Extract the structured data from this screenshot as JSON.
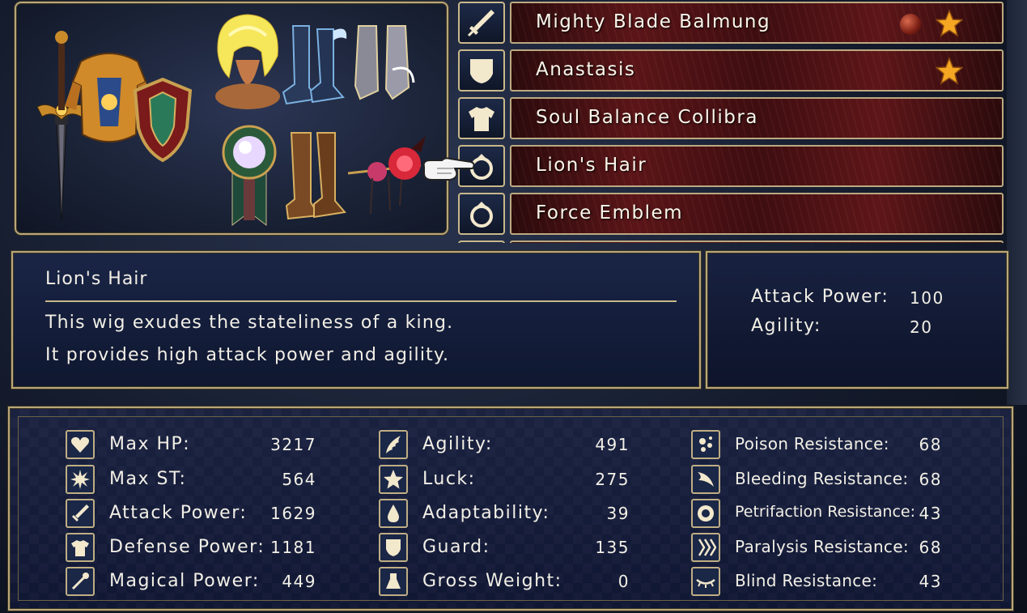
{
  "equipment": [
    {
      "label": "Mighty Blade Balmung",
      "icon": "sword-icon",
      "orb": true,
      "star": true
    },
    {
      "label": "Anastasis",
      "icon": "shield-icon",
      "orb": false,
      "star": true
    },
    {
      "label": "Soul Balance Collibra",
      "icon": "armor-icon",
      "orb": false,
      "star": false
    },
    {
      "label": "Lion's Hair",
      "icon": "ring-icon",
      "orb": false,
      "star": false
    },
    {
      "label": "Force Emblem",
      "icon": "ring-icon",
      "orb": false,
      "star": false
    }
  ],
  "description": {
    "title": "Lion's Hair",
    "line1": "This wig exudes the stateliness of a king.",
    "line2": "It provides high attack power and agility."
  },
  "item_stats": {
    "attack_label": "Attack Power:",
    "attack_value": "100",
    "agility_label": "Agility:",
    "agility_value": "20"
  },
  "stats": {
    "col1": [
      {
        "label": "Max HP:",
        "value": "3217",
        "icon": "heart-icon"
      },
      {
        "label": "Max ST:",
        "value": "564",
        "icon": "burst-icon"
      },
      {
        "label": "Attack Power:",
        "value": "1629",
        "icon": "sword-icon"
      },
      {
        "label": "Defense Power:",
        "value": "1181",
        "icon": "armor-icon"
      },
      {
        "label": "Magical Power:",
        "value": "449",
        "icon": "wand-icon"
      }
    ],
    "col2": [
      {
        "label": "Agility:",
        "value": "491",
        "icon": "wing-icon"
      },
      {
        "label": "Luck:",
        "value": "275",
        "icon": "star-icon"
      },
      {
        "label": "Adaptability:",
        "value": "39",
        "icon": "drop-icon"
      },
      {
        "label": "Guard:",
        "value": "135",
        "icon": "shield-icon"
      },
      {
        "label": "Gross Weight:",
        "value": "0",
        "icon": "weight-icon"
      }
    ],
    "col3": [
      {
        "label": "Poison Resistance:",
        "value": "68",
        "icon": "poison-icon"
      },
      {
        "label": "Bleeding Resistance:",
        "value": "68",
        "icon": "bleed-icon"
      },
      {
        "label": "Petrifaction Resistance:",
        "value": "43",
        "icon": "petrify-icon"
      },
      {
        "label": "Paralysis Resistance:",
        "value": "68",
        "icon": "paralysis-icon"
      },
      {
        "label": "Blind Resistance:",
        "value": "43",
        "icon": "eye-closed-icon"
      }
    ]
  },
  "colors": {
    "frame": "#c9b88a",
    "panel": "#1a2546",
    "row_red": "#5a1518",
    "star": "#f5a623"
  }
}
